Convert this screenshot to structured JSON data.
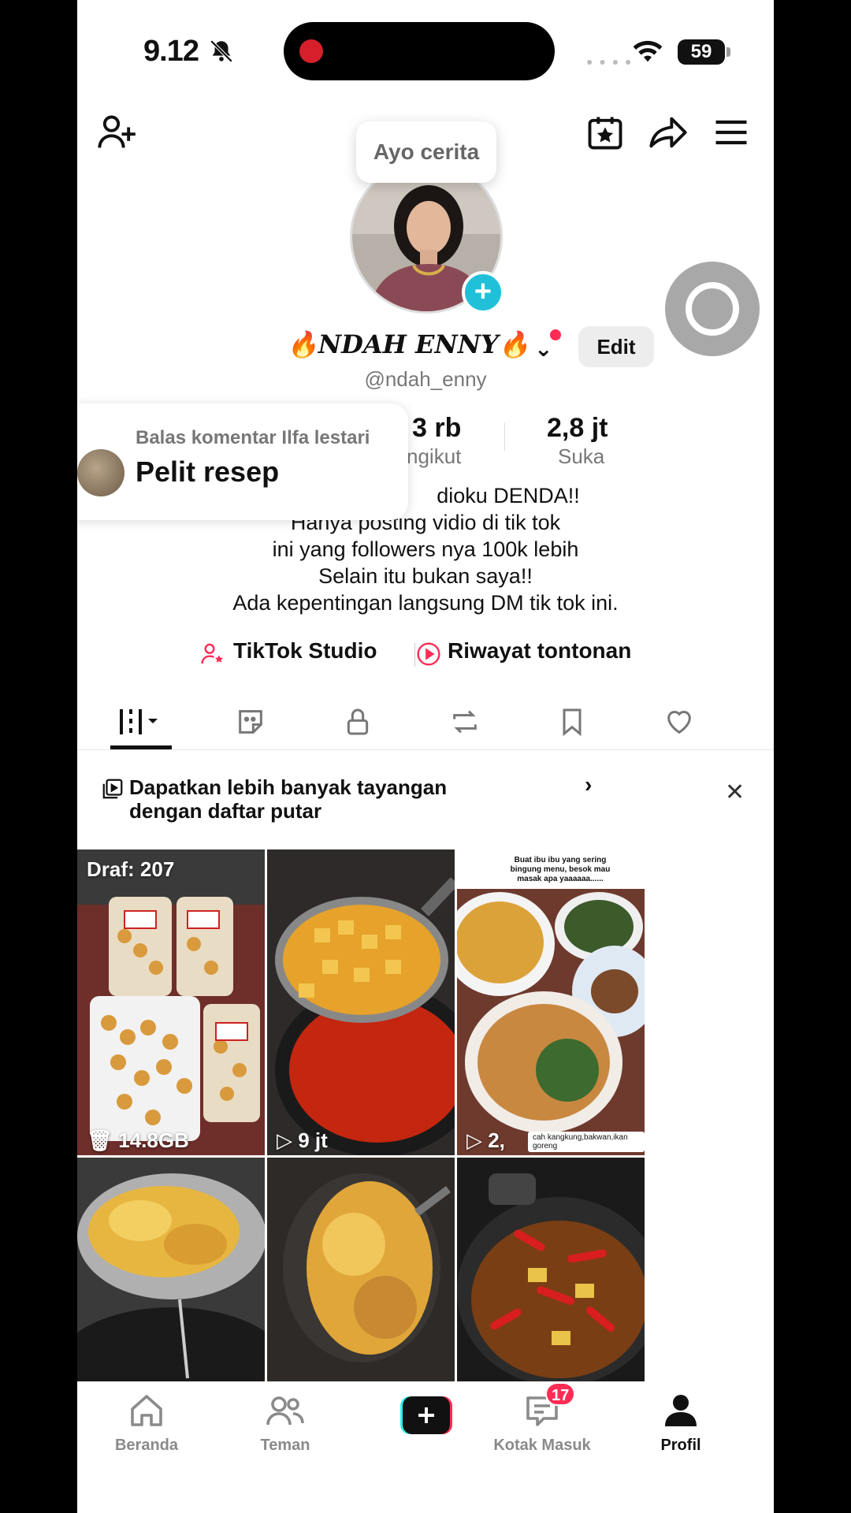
{
  "status_bar": {
    "time": "9.12",
    "battery": "59"
  },
  "header": {
    "story_prompt": "Ayo cerita"
  },
  "profile": {
    "display_name": "🔥NDAH ENNY🔥",
    "username": "@ndah_enny",
    "edit_label": "Edit",
    "stats": [
      {
        "value": "3 rb",
        "label": "ngikut"
      },
      {
        "value": "2,8 jt",
        "label": "Suka"
      }
    ],
    "bio": [
      "dioku DENDA!!",
      "Hanya posting vidio di tik tok",
      "ini yang followers nya 100k lebih",
      "Selain itu bukan saya!!",
      "Ada kepentingan langsung DM tik tok ini."
    ]
  },
  "comment_popup": {
    "title": "Balas komentar Ilfa lestari",
    "text": "Pelit resep"
  },
  "links": {
    "studio": "TikTok Studio",
    "history": "Riwayat tontonan"
  },
  "tabs": [
    "videos",
    "stickers",
    "private",
    "reposts",
    "favorites",
    "liked"
  ],
  "banner": {
    "text": "Dapatkan lebih banyak tayangan dengan daftar putar"
  },
  "grid": [
    {
      "label": "Draf: 207",
      "footer": "14.8GB"
    },
    {
      "footer": "9 jt"
    },
    {
      "caption_top": "Buat ibu ibu yang sering bingung menu, besok mau masak apa yaaaaaa......",
      "footer": "2,",
      "caption_bottom": "cah kangkung,bakwan,ikan goreng"
    },
    {},
    {},
    {}
  ],
  "bottom_nav": {
    "home": "Beranda",
    "friends": "Teman",
    "inbox": "Kotak Masuk",
    "inbox_badge": "17",
    "profile": "Profil"
  },
  "colors": {
    "accent": "#fe2c55",
    "cyan": "#20c1d8"
  }
}
